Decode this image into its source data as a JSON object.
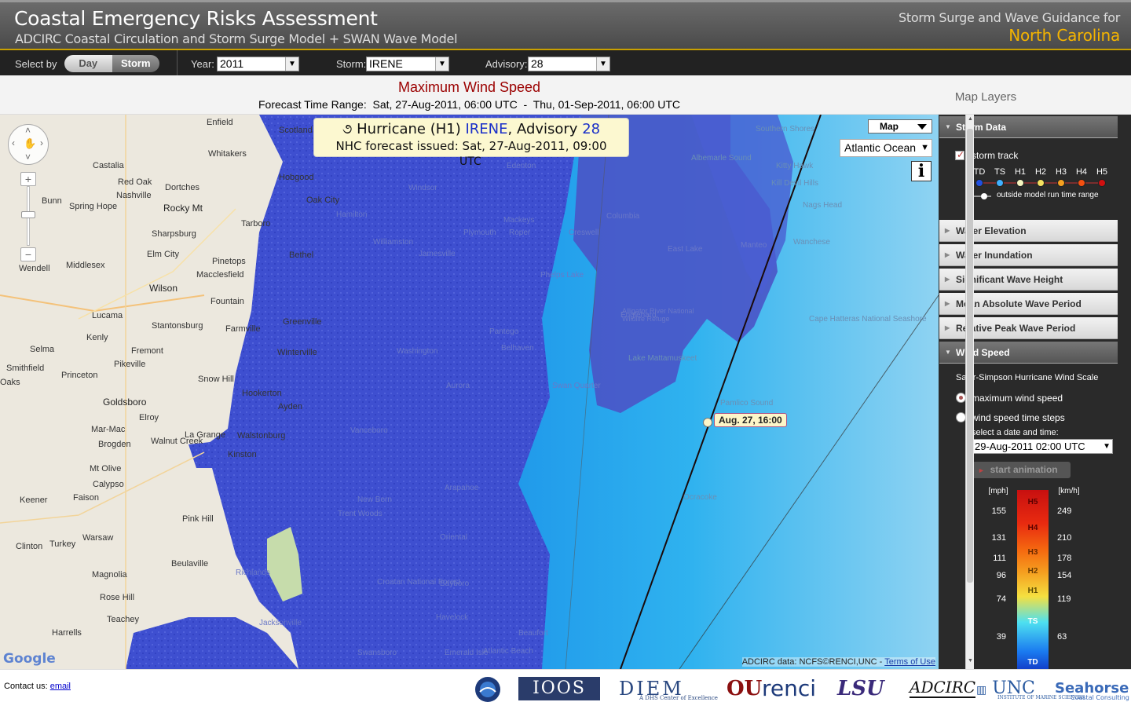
{
  "header": {
    "title": "Coastal Emergency Risks Assessment",
    "subtitle": "ADCIRC Coastal Circulation and Storm Surge Model + SWAN Wave Model",
    "guidance": "Storm Surge and Wave Guidance for",
    "region": "North Carolina"
  },
  "toolbar": {
    "select_by_label": "Select by",
    "day_label": "Day",
    "storm_label": "Storm",
    "year_label": "Year:",
    "year_value": "2011",
    "storm_field_label": "Storm:",
    "storm_value": "IRENE",
    "advisory_label": "Advisory:",
    "advisory_value": "28"
  },
  "titlebar": {
    "title": "Maximum Wind Speed",
    "range_label": "Forecast Time Range:",
    "range_start": "Sat, 27-Aug-2011, 06:00 UTC",
    "range_sep": "-",
    "range_end": "Thu, 01-Sep-2011, 06:00 UTC",
    "layers_label": "Map Layers"
  },
  "storm_box": {
    "symbol": "૭",
    "prefix": "Hurricane (H1)",
    "name": "IRENE",
    "advisory_text": ", Advisory",
    "advisory_num": "28",
    "issued_label": "NHC forecast issued: Sat, 27-Aug-2011, 09:00",
    "issued_tail": "UTC"
  },
  "map": {
    "type_value": "Map",
    "region_value": "Atlantic Ocean",
    "info_symbol": "i",
    "track_label": "Aug. 27, 16:00",
    "attribution_prefix": "ADCIRC data: NCFS©RENCI,UNC -",
    "terms_link": "Terms of Use",
    "google": "Google",
    "places": [
      {
        "name": "Enfield"
      },
      {
        "name": "Scotland Neck"
      },
      {
        "name": "Whitakers"
      },
      {
        "name": "Castalia"
      },
      {
        "name": "Red Oak"
      },
      {
        "name": "Nashville"
      },
      {
        "name": "Dortches"
      },
      {
        "name": "Hobgood"
      },
      {
        "name": "Bunn"
      },
      {
        "name": "Spring Hope"
      },
      {
        "name": "Rocky Mt"
      },
      {
        "name": "Oak City"
      },
      {
        "name": "Tarboro"
      },
      {
        "name": "Sharpsburg"
      },
      {
        "name": "Elm City"
      },
      {
        "name": "Pinetops"
      },
      {
        "name": "Bethel"
      },
      {
        "name": "Macclesfield"
      },
      {
        "name": "Wendell"
      },
      {
        "name": "Middlesex"
      },
      {
        "name": "Wilson"
      },
      {
        "name": "Fountain"
      },
      {
        "name": "Lucama"
      },
      {
        "name": "Stantonsburg"
      },
      {
        "name": "Farmville"
      },
      {
        "name": "Greenville"
      },
      {
        "name": "Kenly"
      },
      {
        "name": "Selma"
      },
      {
        "name": "Fremont"
      },
      {
        "name": "Winterville"
      },
      {
        "name": "Pikeville"
      },
      {
        "name": "Smithfield"
      },
      {
        "name": "Princeton"
      },
      {
        "name": "Snow Hill"
      },
      {
        "name": "Hookerton"
      },
      {
        "name": "Oaks"
      },
      {
        "name": "Goldsboro"
      },
      {
        "name": "Ayden"
      },
      {
        "name": "Elroy"
      },
      {
        "name": "Mar-Mac"
      },
      {
        "name": "La Grange"
      },
      {
        "name": "Walstonburg"
      },
      {
        "name": "Brogden"
      },
      {
        "name": "Walnut Creek"
      },
      {
        "name": "Kinston"
      },
      {
        "name": "Mt Olive"
      },
      {
        "name": "Calypso"
      },
      {
        "name": "Keener"
      },
      {
        "name": "Faison"
      },
      {
        "name": "Pink Hill"
      },
      {
        "name": "Warsaw"
      },
      {
        "name": "Clinton"
      },
      {
        "name": "Turkey"
      },
      {
        "name": "Beulaville"
      },
      {
        "name": "Magnolia"
      },
      {
        "name": "Rose Hill"
      },
      {
        "name": "Teachey"
      },
      {
        "name": "Harrells"
      },
      {
        "name": "Richlands"
      },
      {
        "name": "Jacksonville"
      },
      {
        "name": "Williamston"
      },
      {
        "name": "Jamesville"
      },
      {
        "name": "Plymouth"
      },
      {
        "name": "Windsor"
      },
      {
        "name": "Hamilton"
      },
      {
        "name": "Washington"
      },
      {
        "name": "New Bern"
      },
      {
        "name": "Trent Woods"
      },
      {
        "name": "Croatan National Forest"
      },
      {
        "name": "Havelock"
      },
      {
        "name": "Swansboro"
      },
      {
        "name": "Beaufort"
      },
      {
        "name": "Atlantic Beach"
      },
      {
        "name": "Emerald Isle"
      },
      {
        "name": "Belhaven"
      },
      {
        "name": "Pantego"
      },
      {
        "name": "Phelps Lake"
      },
      {
        "name": "Columbia"
      },
      {
        "name": "Creswell"
      },
      {
        "name": "Roper"
      },
      {
        "name": "Mackeys"
      },
      {
        "name": "Edenton"
      },
      {
        "name": "Albemarle Sound"
      },
      {
        "name": "Southern Shores"
      },
      {
        "name": "Kitty Hawk"
      },
      {
        "name": "Kill Devil Hills"
      },
      {
        "name": "Nags Head"
      },
      {
        "name": "Wanchese"
      },
      {
        "name": "East Lake"
      },
      {
        "name": "Manteo"
      },
      {
        "name": "Lake Mattamuskeet"
      },
      {
        "name": "Pamlico Sound"
      },
      {
        "name": "Cape Hatteras National Seashore"
      },
      {
        "name": "Ocracoke"
      },
      {
        "name": "Aurora"
      },
      {
        "name": "Vanceboro"
      },
      {
        "name": "Arapahoe"
      },
      {
        "name": "Oriental"
      },
      {
        "name": "Bayboro"
      },
      {
        "name": "Swan Quarter"
      },
      {
        "name": "Englehard"
      },
      {
        "name": "Alligator River National Wildlife Refuge"
      }
    ]
  },
  "panel": {
    "storm_data": "Storm Data",
    "storm_track": "storm track",
    "categories": [
      "TD",
      "TS",
      "H1",
      "H2",
      "H3",
      "H4",
      "H5"
    ],
    "category_colors": [
      "#2050e0",
      "#40b0ff",
      "#f5f5c0",
      "#f5e060",
      "#f5a020",
      "#f55010",
      "#d01010"
    ],
    "outside_range": "outside model run time range",
    "water_elevation": "Water Elevation",
    "water_inundation": "Water Inundation",
    "sig_wave_height": "Significant Wave Height",
    "mean_wave_period": "Mean Absolute Wave Period",
    "rel_peak_wave_period": "Relative Peak Wave Period",
    "wind_speed": "Wind Speed",
    "scale_title": "Saffir-Simpson Hurricane Wind Scale",
    "max_wind": "maximum wind speed",
    "wind_steps": "wind speed time steps",
    "select_date": "select a date and time:",
    "date_value": "29-Aug-2011 02:00 UTC",
    "animation": "start animation",
    "animation_icon": "►",
    "mph_label": "[mph]",
    "kmh_label": "[km/h]",
    "mph_ticks": [
      "155",
      "131",
      "111",
      "96",
      "74",
      "39"
    ],
    "kmh_ticks": [
      "249",
      "210",
      "178",
      "154",
      "119",
      "63"
    ],
    "bands": [
      "H5",
      "H4",
      "H3",
      "H2",
      "H1",
      "TS",
      "TD"
    ]
  },
  "footer": {
    "contact_label": "Contact us:",
    "email": "email",
    "logos": [
      "NOAA",
      "IOOS",
      "DIEM",
      "OU",
      "renci",
      "LSU",
      "ADCIRC",
      "UNC",
      "Seahorse"
    ],
    "diem_sub": "A DHS Center of Excellence",
    "unc_sub": "INSTITUTE OF MARINE SCIENCES",
    "seahorse_sub": "Coastal Consulting"
  }
}
